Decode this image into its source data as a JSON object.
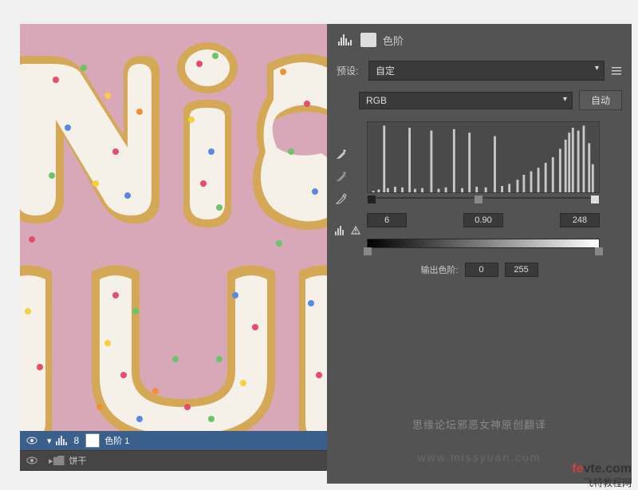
{
  "panel": {
    "title": "色阶",
    "preset_label": "预设:",
    "preset_value": "自定",
    "channel_value": "RGB",
    "auto_button": "自动",
    "input_shadow": "6",
    "input_mid": "0.90",
    "input_highlight": "248",
    "output_label": "输出色阶:",
    "output_low": "0",
    "output_high": "255"
  },
  "layers": {
    "levels_layer": "色阶 1",
    "group_layer": "饼干"
  },
  "credits": {
    "text": "思缘论坛邪恶女神原创翻译",
    "url": "www.missyuan.com"
  },
  "watermark": {
    "domain_part1": "fe",
    "domain_part2": "vte",
    "domain_suffix": ".com",
    "sub": "飞特教程网"
  },
  "chart_data": {
    "type": "histogram",
    "xlim": [
      0,
      255
    ],
    "ylim": [
      0,
      100
    ],
    "bins": [
      {
        "x": 6,
        "h": 2
      },
      {
        "x": 12,
        "h": 4
      },
      {
        "x": 18,
        "h": 95
      },
      {
        "x": 22,
        "h": 6
      },
      {
        "x": 30,
        "h": 8
      },
      {
        "x": 38,
        "h": 7
      },
      {
        "x": 46,
        "h": 92
      },
      {
        "x": 52,
        "h": 5
      },
      {
        "x": 60,
        "h": 6
      },
      {
        "x": 70,
        "h": 88
      },
      {
        "x": 78,
        "h": 5
      },
      {
        "x": 86,
        "h": 7
      },
      {
        "x": 95,
        "h": 90
      },
      {
        "x": 104,
        "h": 6
      },
      {
        "x": 112,
        "h": 85
      },
      {
        "x": 120,
        "h": 8
      },
      {
        "x": 130,
        "h": 7
      },
      {
        "x": 140,
        "h": 80
      },
      {
        "x": 148,
        "h": 9
      },
      {
        "x": 156,
        "h": 12
      },
      {
        "x": 165,
        "h": 18
      },
      {
        "x": 172,
        "h": 25
      },
      {
        "x": 180,
        "h": 30
      },
      {
        "x": 188,
        "h": 35
      },
      {
        "x": 196,
        "h": 42
      },
      {
        "x": 204,
        "h": 50
      },
      {
        "x": 212,
        "h": 62
      },
      {
        "x": 218,
        "h": 75
      },
      {
        "x": 222,
        "h": 85
      },
      {
        "x": 226,
        "h": 92
      },
      {
        "x": 232,
        "h": 88
      },
      {
        "x": 238,
        "h": 95
      },
      {
        "x": 244,
        "h": 70
      },
      {
        "x": 248,
        "h": 40
      }
    ],
    "input_markers": {
      "shadow": 6,
      "mid": 0.9,
      "highlight": 248
    },
    "output_markers": {
      "low": 0,
      "high": 255
    }
  }
}
